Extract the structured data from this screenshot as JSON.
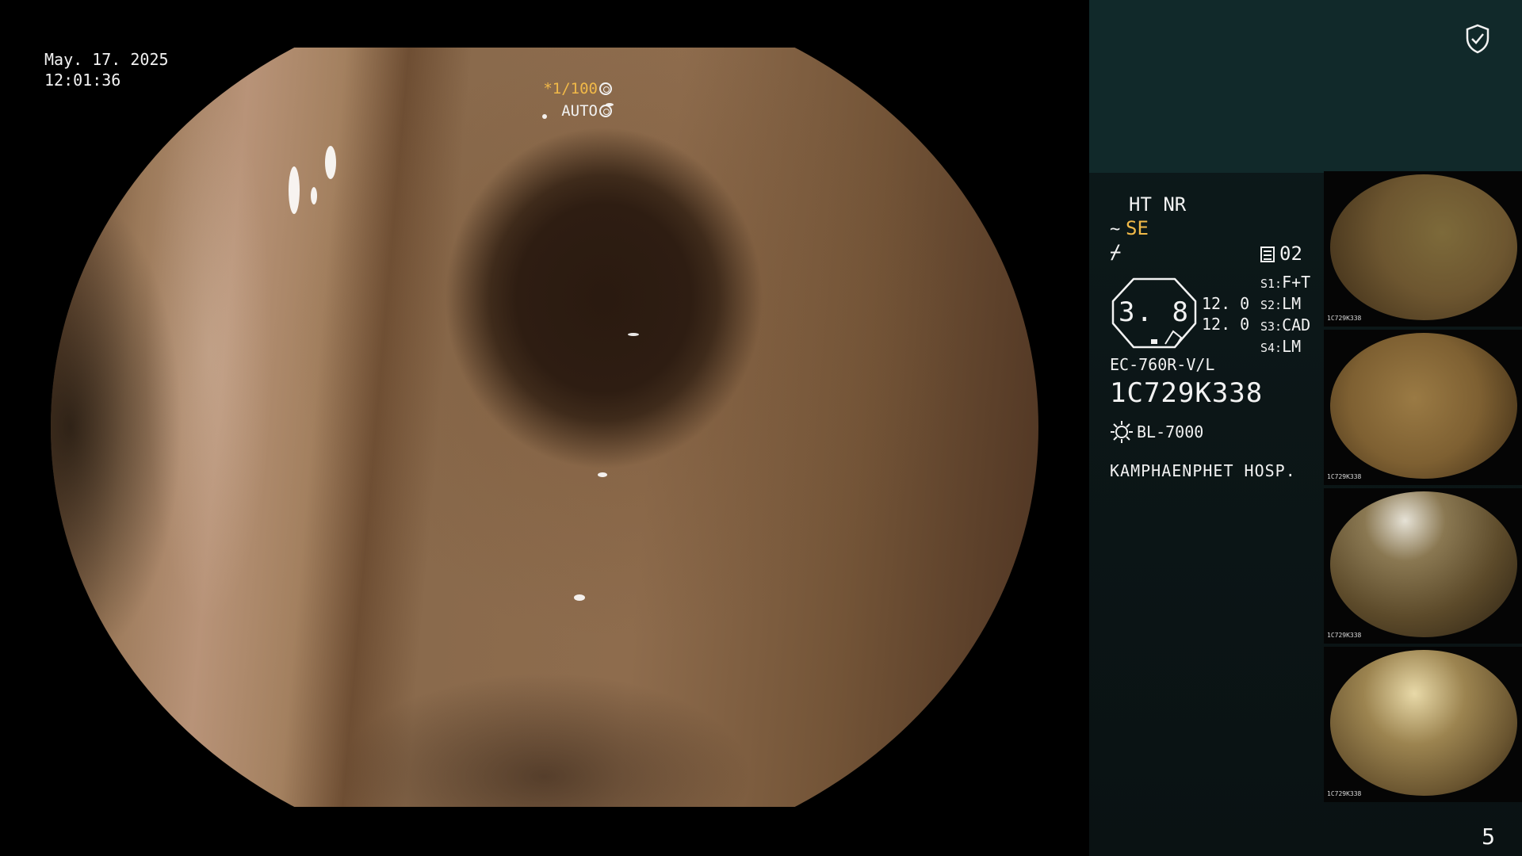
{
  "overlay": {
    "date": "May. 17. 2025",
    "time": "12:01:36",
    "shutter": "*1/100",
    "iris": "AUTO"
  },
  "panel": {
    "modes": "HT NR",
    "structure_enhancement": "SE",
    "memo_count": "02",
    "magnification": "3. 8",
    "gauge_values": [
      "12. 0",
      "12. 0"
    ],
    "stations": [
      {
        "label": "S1:",
        "value": "F+T"
      },
      {
        "label": "S2:",
        "value": "LM"
      },
      {
        "label": "S3:",
        "value": "CAD"
      },
      {
        "label": "S4:",
        "value": "LM"
      }
    ],
    "scope_model": "EC-760R-V/L",
    "scope_serial": "1C729K338",
    "light_source": "BL-7000",
    "hospital": "KAMPHAENPHET HOSP."
  },
  "thumbnails": [
    {
      "caption": "1C729K338"
    },
    {
      "caption": "1C729K338"
    },
    {
      "caption": "1C729K338"
    },
    {
      "caption": "1C729K338"
    }
  ],
  "page_number": "5",
  "colors": {
    "accent_amber": "#f1b948",
    "panel_top": "#11292a",
    "panel_bottom": "#0a1213"
  },
  "icons": [
    "shield-check-icon",
    "squiggle-icon",
    "snare-icon",
    "memo-icon",
    "light-source-icon",
    "aperture-icon"
  ]
}
